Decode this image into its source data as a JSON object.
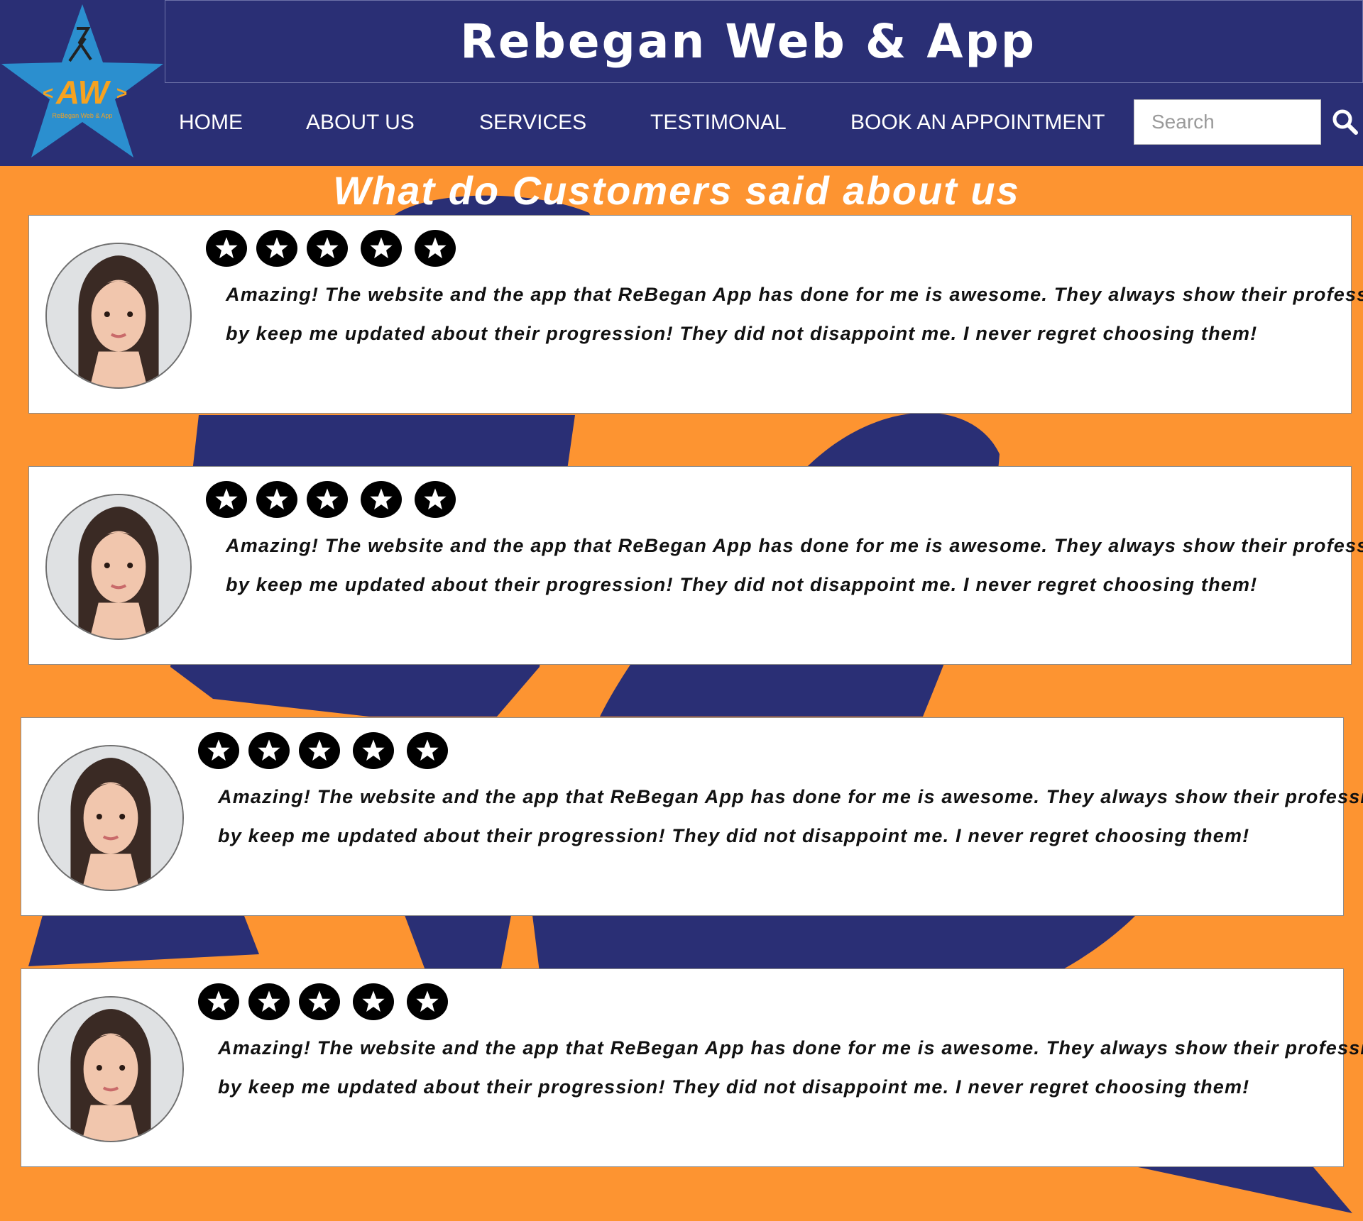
{
  "colors": {
    "background_orange": "#fd9431",
    "navy": "#2a2f75",
    "logo_star_blue": "#2b8fcf",
    "logo_text_orange": "#f6a21f",
    "white": "#ffffff",
    "star_badge_black": "#000000"
  },
  "logo": {
    "monogram": "AW",
    "tagline": "ReBegan Web & App"
  },
  "header": {
    "title": "Rebegan Web & App"
  },
  "nav": {
    "items": [
      {
        "label": "HOME"
      },
      {
        "label": "ABOUT US"
      },
      {
        "label": "SERVICES"
      },
      {
        "label": "TESTIMONAL"
      },
      {
        "label": "BOOK AN APPOINTMENT"
      }
    ]
  },
  "search": {
    "placeholder": "Search",
    "value": "",
    "icon": "search-icon"
  },
  "section": {
    "heading": "What do Customers said about us"
  },
  "testimonials": [
    {
      "rating": 5,
      "text": "Amazing! The website and the app that ReBegan App has done for me is awesome. They always show their professional",
      "text_line2": "by keep me updated about their progression! They did not disappoint me. I never regret choosing them!",
      "icon": "avatar-photo"
    },
    {
      "rating": 5,
      "text": "Amazing! The website and the app that ReBegan App has done for me is awesome. They always show their professional",
      "text_line2": "by keep me updated about their progression! They did not disappoint me. I never regret choosing them!",
      "icon": "avatar-photo"
    },
    {
      "rating": 5,
      "text": "Amazing! The website and the app that ReBegan App has done for me is awesome. They always show their professional",
      "text_line2": "by keep me updated about their progression! They did not disappoint me. I never regret choosing them!",
      "icon": "avatar-photo"
    },
    {
      "rating": 5,
      "text": "Amazing! The website and the app that ReBegan App has done for me is awesome. They always show their professional",
      "text_line2": "by keep me updated about their progression! They did not disappoint me. I never regret choosing them!",
      "icon": "avatar-photo"
    }
  ]
}
